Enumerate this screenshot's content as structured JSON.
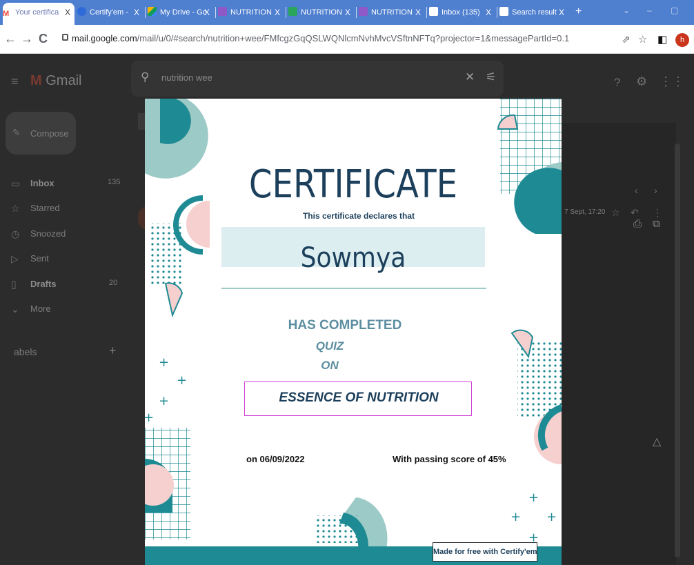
{
  "browser": {
    "tabs": [
      {
        "title": "Your certifica",
        "active": true,
        "favicon_color": "#ea4335"
      },
      {
        "title": "Certify'em - ",
        "active": false,
        "favicon_color": "#2f6bd8"
      },
      {
        "title": "My Drive - Go",
        "active": false,
        "favicon_color": "#f4b400"
      },
      {
        "title": "NUTRITION ",
        "active": false,
        "favicon_color": "#8e58c7"
      },
      {
        "title": "NUTRITION ",
        "active": false,
        "favicon_color": "#2aa55b"
      },
      {
        "title": "NUTRITION ",
        "active": false,
        "favicon_color": "#8e58c7"
      },
      {
        "title": "Inbox (135) ",
        "active": false,
        "favicon_color": "#ea4335"
      },
      {
        "title": "Search result",
        "active": false,
        "favicon_color": "#ea4335"
      }
    ],
    "close_glyph": "X",
    "new_tab_glyph": "+",
    "window_controls": [
      "⌄",
      "–",
      "▢"
    ],
    "url_host": "mail.google.com",
    "url_path": "/mail/u/0/#search/nutrition+wee/FMfcgzGqQSLWQNlcmNvhMvcVSftnNFTq?projector=1&messagePartId=0.1",
    "profile_initial": "h"
  },
  "gmail": {
    "app_name": "Gmail",
    "search_query": "nutrition wee",
    "compose_label": "Compose",
    "nav": [
      {
        "label": "Inbox",
        "count": "135",
        "bold": true
      },
      {
        "label": "Starred",
        "count": "",
        "bold": false
      },
      {
        "label": "Snoozed",
        "count": "",
        "bold": false
      },
      {
        "label": "Sent",
        "count": "",
        "bold": false
      },
      {
        "label": "Drafts",
        "count": "20",
        "bold": true
      },
      {
        "label": "More",
        "count": "",
        "bold": false
      }
    ],
    "labels_heading": "abels",
    "labels_add": "+",
    "message_time": "7 Sept, 17:20"
  },
  "certificate": {
    "title": "CERTIFICATE",
    "subtitle": "This certificate declares that",
    "recipient": "Sowmya",
    "has_completed": "HAS COMPLETED",
    "quiz": "QUIZ",
    "on": "ON",
    "topic": "ESSENCE OF NUTRITION",
    "date": "on 06/09/2022",
    "score": "With passing score of 45%",
    "badge": "Made for free with Certify'em"
  },
  "colors": {
    "tabstrip": "#4f7fcf",
    "navy": "#1c3f5b",
    "teal": "#1e8a93",
    "light_teal": "#9ccac7",
    "pink": "#f6cfcf",
    "topic_border": "#d23fd4"
  },
  "icons": [
    "back-arrow-icon",
    "forward-arrow-icon",
    "reload-icon",
    "lock-icon",
    "share-icon",
    "star-icon",
    "sidepanel-icon",
    "search-icon",
    "clear-icon",
    "filter-icon",
    "help-icon",
    "settings-icon",
    "apps-icon",
    "print-icon",
    "open-new-icon",
    "reply-icon",
    "more-icon",
    "inbox-icon",
    "starred-icon",
    "snoozed-icon",
    "sent-icon",
    "drafts-icon",
    "more-chevron-icon",
    "drive-icon"
  ]
}
